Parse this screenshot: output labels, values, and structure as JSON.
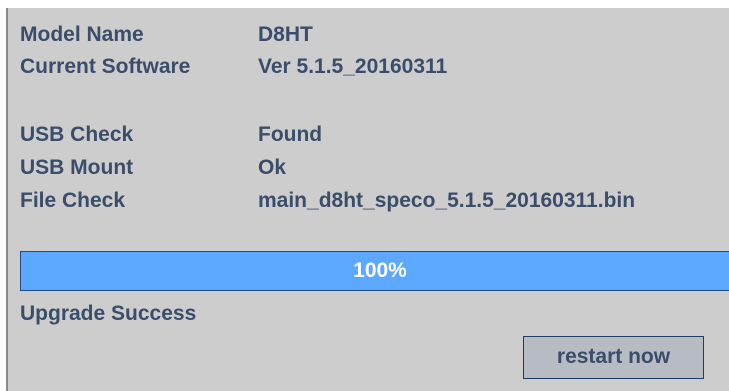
{
  "info": {
    "model_name_label": "Model Name",
    "model_name_value": "D8HT",
    "current_software_label": "Current Software",
    "current_software_value": "Ver 5.1.5_20160311",
    "usb_check_label": "USB Check",
    "usb_check_value": "Found",
    "usb_mount_label": "USB Mount",
    "usb_mount_value": "Ok",
    "file_check_label": "File Check",
    "file_check_value": "main_d8ht_speco_5.1.5_20160311.bin"
  },
  "progress": {
    "percent": 100,
    "label": "100%"
  },
  "status": {
    "text": "Upgrade Success"
  },
  "actions": {
    "restart_label": "restart now"
  },
  "colors": {
    "panel_background": "#cdcdcd",
    "text": "#3a4d6a",
    "progress_fill": "#5da8ff",
    "progress_text": "#ffffff",
    "button_background": "#b7bcc3"
  }
}
